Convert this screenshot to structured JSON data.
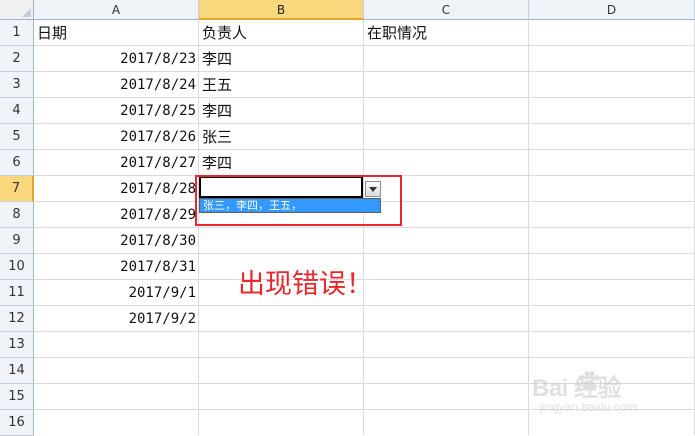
{
  "columns": [
    "A",
    "B",
    "C",
    "D"
  ],
  "rows": [
    "1",
    "2",
    "3",
    "4",
    "5",
    "6",
    "7",
    "8",
    "9",
    "10",
    "11",
    "12",
    "13",
    "14",
    "15",
    "16"
  ],
  "headers": {
    "a1": "日期",
    "b1": "负责人",
    "c1": "在职情况"
  },
  "dates": [
    "2017/8/23",
    "2017/8/24",
    "2017/8/25",
    "2017/8/26",
    "2017/8/27",
    "2017/8/28",
    "2017/8/29",
    "2017/8/30",
    "2017/8/31",
    "2017/9/1",
    "2017/9/2"
  ],
  "people": [
    "李四",
    "王五",
    "李四",
    "张三",
    "李四"
  ],
  "dropdown": {
    "option": "张三，李四，王五，"
  },
  "annotation": "出现错误！",
  "watermark": {
    "main": "Bai  经验",
    "sub": "jingyan.baidu.com"
  },
  "colors": {
    "annotation": "#e8282c",
    "selection": "#3399ff",
    "header_active": "#f8d77d"
  }
}
